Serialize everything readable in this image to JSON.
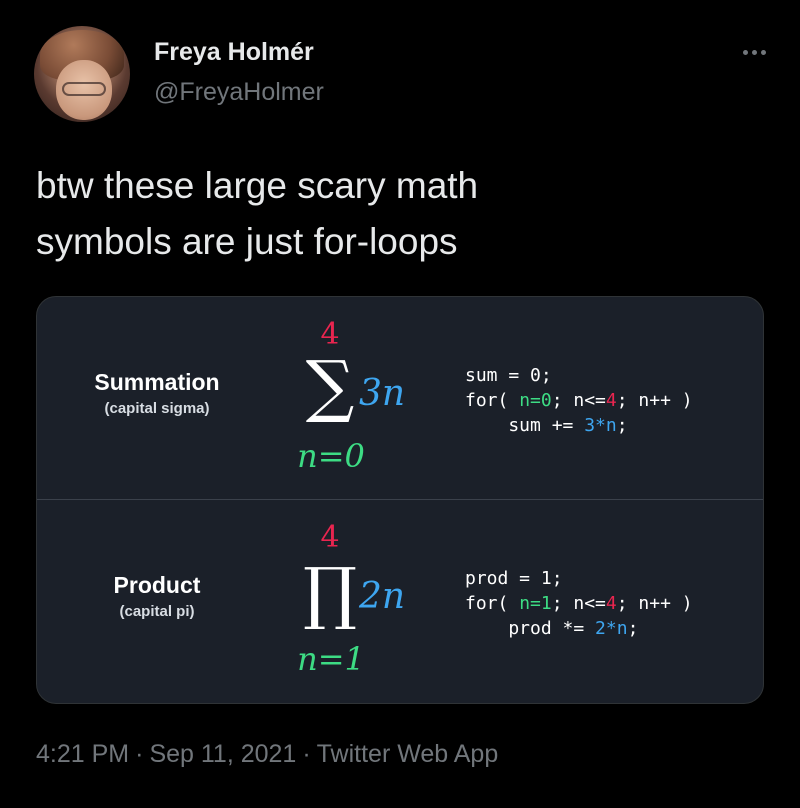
{
  "author": {
    "name": "Freya Holmér",
    "handle": "@FreyaHolmer"
  },
  "tweet": {
    "text_line1": "btw these large scary math",
    "text_line2": "symbols are just for-loops"
  },
  "card": {
    "summation": {
      "label": "Summation",
      "sublabel": "(capital sigma)",
      "upper": "4",
      "symbol": "∑",
      "term": "3n",
      "lower": "n=0",
      "code_line1": "sum = 0;",
      "code_line2_a": "for( ",
      "code_line2_init": "n=0",
      "code_line2_b": "; n<=",
      "code_line2_max": "4",
      "code_line2_c": "; n++ )",
      "code_line3_a": "    sum += ",
      "code_line3_expr": "3*n",
      "code_line3_b": ";"
    },
    "product": {
      "label": "Product",
      "sublabel": "(capital pi)",
      "upper": "4",
      "symbol": "∏",
      "term": "2n",
      "lower": "n=1",
      "code_line1": "prod = 1;",
      "code_line2_a": "for( ",
      "code_line2_init": "n=1",
      "code_line2_b": "; n<=",
      "code_line2_max": "4",
      "code_line2_c": "; n++ )",
      "code_line3_a": "    prod *= ",
      "code_line3_expr": "2*n",
      "code_line3_b": ";"
    }
  },
  "meta": {
    "time": "4:21 PM",
    "date": "Sep 11, 2021",
    "app": "Twitter Web App",
    "separator": "·"
  },
  "colors": {
    "background": "#000000",
    "card": "#1b2029",
    "upper_limit": "#e8254f",
    "lower_limit": "#3ddc84",
    "term": "#3ea6f0",
    "muted": "#71767b"
  },
  "icons": {
    "more": "more-horizontal-icon"
  }
}
